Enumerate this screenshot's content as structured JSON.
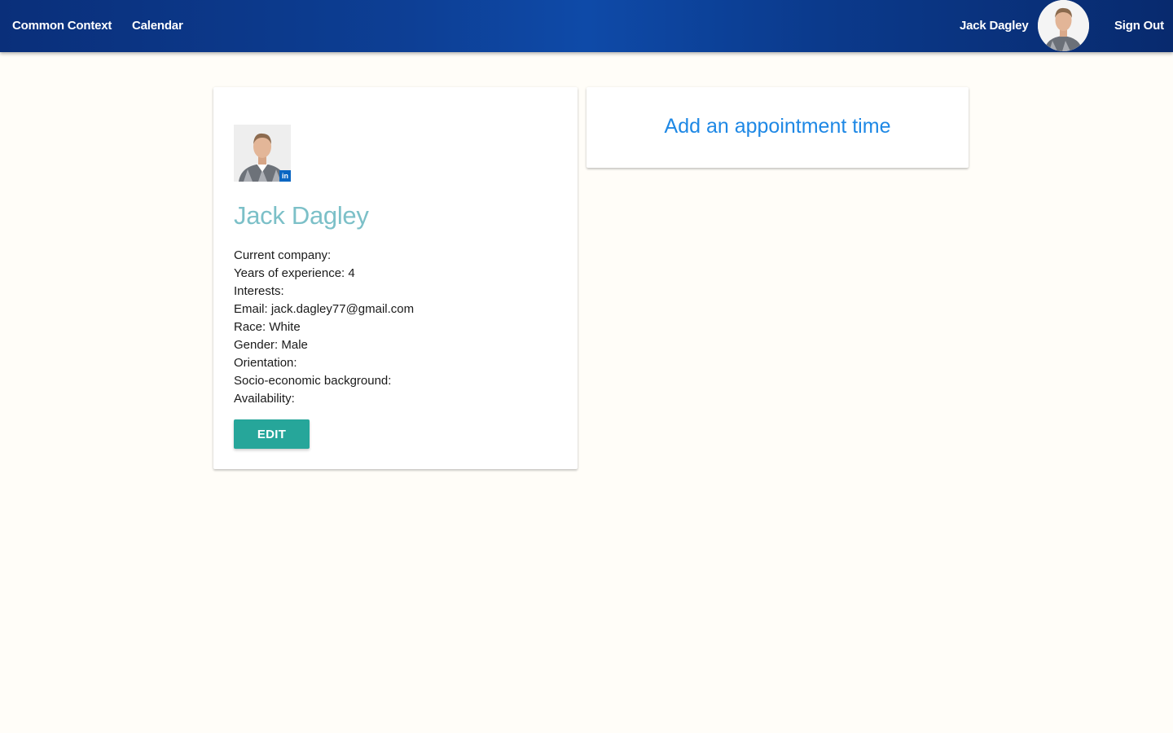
{
  "nav": {
    "brand": "Common Context",
    "calendar": "Calendar",
    "user_name": "Jack Dagley",
    "sign_out": "Sign Out"
  },
  "profile": {
    "name": "Jack Dagley",
    "linkedin_badge": "in",
    "details": [
      "Current company:",
      "Years of experience: 4",
      "Interests:",
      "Email: jack.dagley77@gmail.com",
      "Race: White",
      "Gender: Male",
      "Orientation:",
      "Socio-economic background:",
      "Availability:"
    ],
    "edit_label": "EDIT"
  },
  "appointment": {
    "link_label": "Add an appointment time"
  },
  "colors": {
    "nav_gradient_start": "#0a2f7a",
    "nav_gradient_mid": "#0e4aa8",
    "name_color": "#7cc0c8",
    "edit_button": "#26a69a",
    "link_color": "#1e88e5",
    "page_bg": "#fffdf8"
  }
}
